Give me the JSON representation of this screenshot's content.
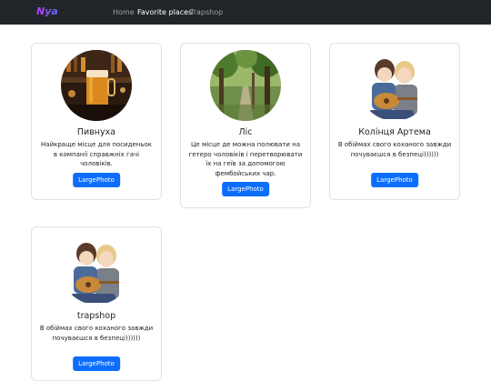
{
  "nav": {
    "brand": "Nya",
    "links": [
      {
        "label": "Home",
        "active": false
      },
      {
        "label": "Favorite places",
        "active": true
      },
      {
        "label": "Trapshop",
        "active": false
      }
    ]
  },
  "cards": [
    {
      "title": "Пивнуха",
      "text": "Найкраще місце для посиденьок в компанії справжніх гачі чоловіків.",
      "button": "LargePhoto",
      "image": "pub-beer-photo"
    },
    {
      "title": "Ліс",
      "text": "Це місце де можна полювати на гетеро чоловіків і перетворювати їх на геїв за допомогою фембойських чар.",
      "button": "LargePhoto",
      "image": "forest-photo"
    },
    {
      "title": "Колінця Артема",
      "text": "В обіймах свого коханого завжди почуваєшся в безпеці))))))",
      "button": "LargePhoto",
      "image": "anime-guitar-couple"
    },
    {
      "title": "trapshop",
      "text": "В обіймах свого коханого завжди почуваєшся в безпеці))))))",
      "button": "LargePhoto",
      "image": "anime-guitar-couple"
    }
  ]
}
